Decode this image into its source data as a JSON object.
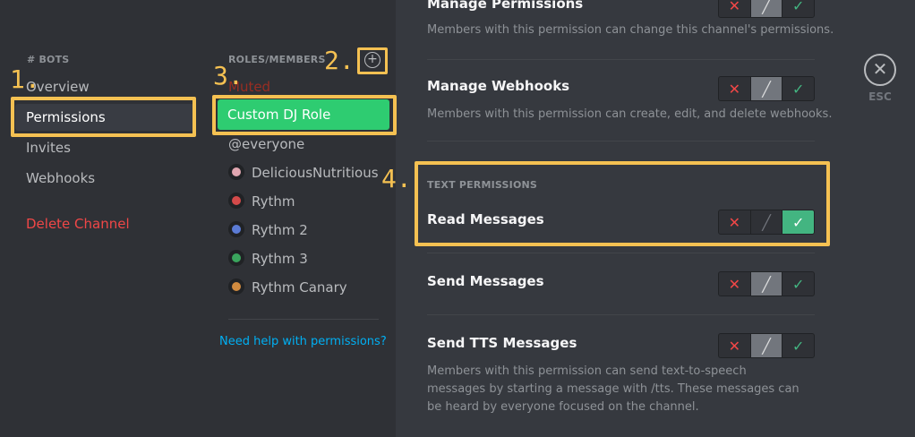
{
  "sidebar": {
    "category": "# BOTS",
    "items": [
      {
        "label": "Overview"
      },
      {
        "label": "Permissions"
      },
      {
        "label": "Invites"
      },
      {
        "label": "Webhooks"
      }
    ],
    "delete_label": "Delete Channel"
  },
  "roles": {
    "header": "ROLES/MEMBERS",
    "add_icon": "plus-circle-icon",
    "items": [
      {
        "label": "Muted"
      },
      {
        "label": "Custom DJ Role"
      },
      {
        "label": "@everyone"
      },
      {
        "label": "DeliciousNutritious"
      },
      {
        "label": "Rythm"
      },
      {
        "label": "Rythm 2"
      },
      {
        "label": "Rythm 3"
      },
      {
        "label": "Rythm Canary"
      }
    ],
    "help_link": "Need help with permissions?"
  },
  "permissions": {
    "manage_permissions": {
      "title": "Manage Permissions",
      "desc": "Members with this permission can change this channel's permissions."
    },
    "manage_webhooks": {
      "title": "Manage Webhooks",
      "desc": "Members with this permission can create, edit, and delete webhooks."
    },
    "text_section": "TEXT PERMISSIONS",
    "read_messages": {
      "title": "Read Messages"
    },
    "send_messages": {
      "title": "Send Messages"
    },
    "send_tts": {
      "title": "Send TTS Messages",
      "desc": "Members with this permission can send text-to-speech messages by starting a message with /tts. These messages can be heard by everyone focused on the channel."
    }
  },
  "switch_glyphs": {
    "deny": "✕",
    "neutral": "╱",
    "allow": "✓"
  },
  "close": {
    "glyph": "✕",
    "label": "ESC"
  },
  "annotations": [
    "1.",
    "2.",
    "3.",
    "4."
  ],
  "colors": {
    "accent_green": "#2ecc71",
    "allow_green": "#43b581",
    "deny_red": "#f04747",
    "annotation_yellow": "#f5c152",
    "link_blue": "#00b0f4"
  }
}
